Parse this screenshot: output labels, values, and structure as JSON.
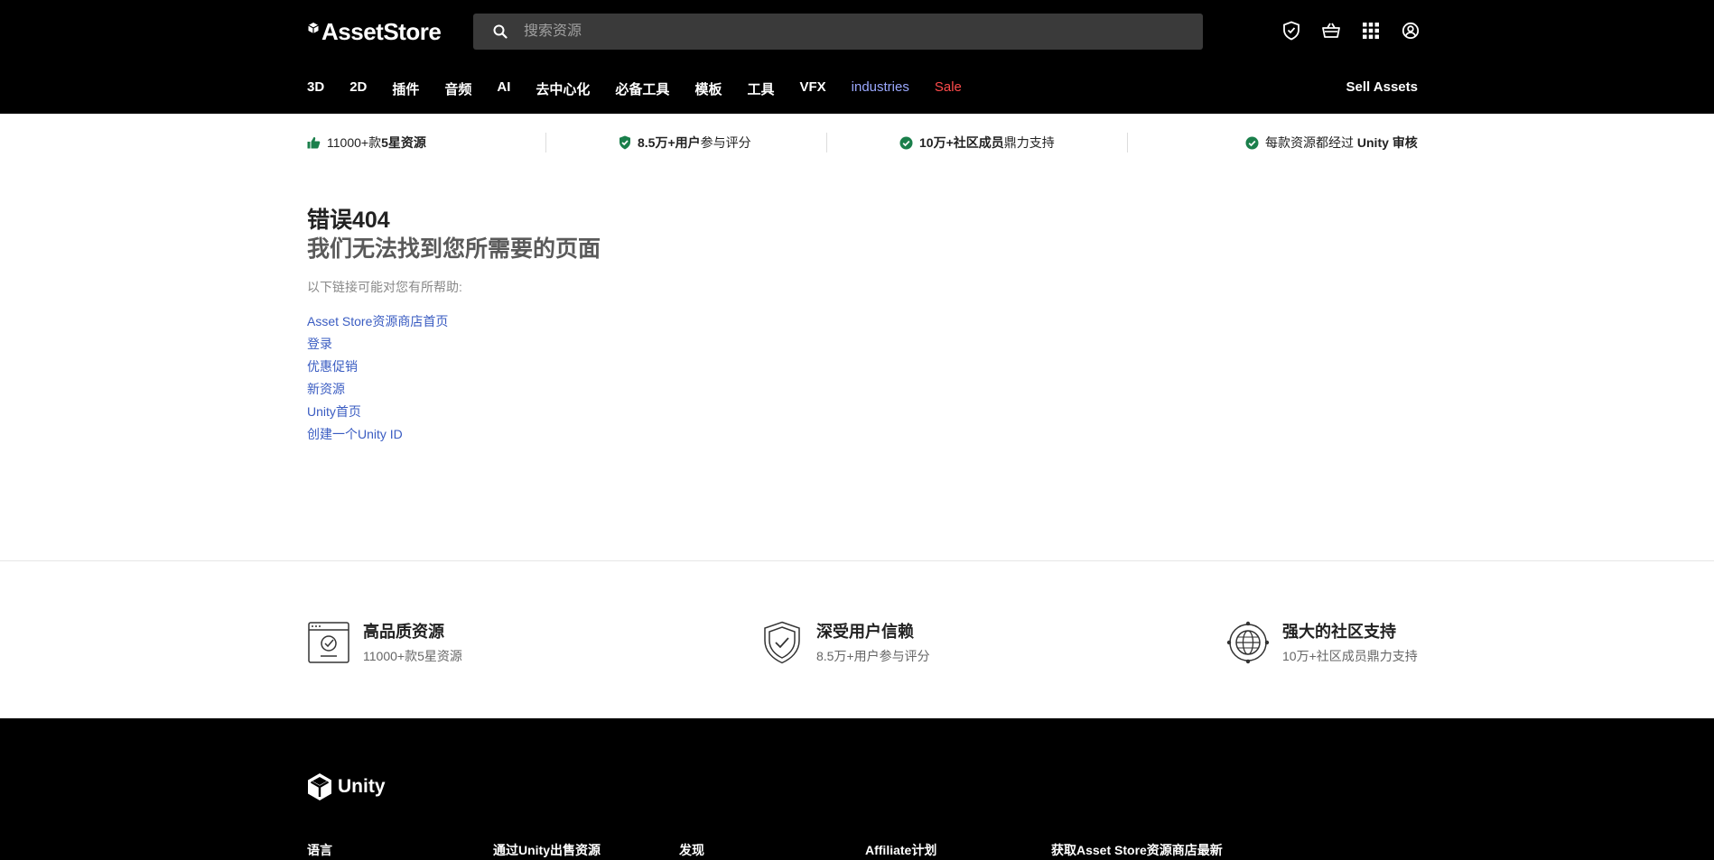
{
  "header": {
    "logo_text": "AssetStore",
    "search_placeholder": "搜索资源",
    "icons": [
      "shield-check-icon",
      "basket-icon",
      "grid-icon",
      "account-icon"
    ],
    "nav": [
      "3D",
      "2D",
      "插件",
      "音频",
      "AI",
      "去中心化",
      "必备工具",
      "模板",
      "工具",
      "VFX",
      "industries",
      "Sale"
    ],
    "sell": "Sell Assets"
  },
  "trust": {
    "item1_pre": "11000+款",
    "item1_bold": "5星资源",
    "item2_bold": "8.5万+用户",
    "item2_post": "参与评分",
    "item3_bold": "10万+社区成员",
    "item3_post": "鼎力支持",
    "item4_pre": "每款资源都经过",
    "item4_bold": "Unity 审核"
  },
  "error": {
    "title": "错误404",
    "subtitle": "我们无法找到您所需要的页面",
    "help_text": "以下链接可能对您有所帮助:",
    "links": [
      "Asset Store资源商店首页",
      "登录",
      "优惠促销",
      "新资源",
      "Unity首页",
      "创建一个Unity ID"
    ]
  },
  "features": [
    {
      "title": "高品质资源",
      "subtitle": "11000+款5星资源"
    },
    {
      "title": "深受用户信赖",
      "subtitle": "8.5万+用户参与评分"
    },
    {
      "title": "强大的社区支持",
      "subtitle": "10万+社区成员鼎力支持"
    }
  ],
  "footer": {
    "logo_text": "Unity",
    "columns": [
      "语言",
      "通过Unity出售资源",
      "发现",
      "Affiliate计划",
      "获取Asset Store资源商店最新"
    ]
  },
  "colors": {
    "accent_link": "#3a5cc2",
    "industries": "#9ba9ff",
    "sale": "#ff4b4b",
    "check_green": "#1a7f4b"
  }
}
